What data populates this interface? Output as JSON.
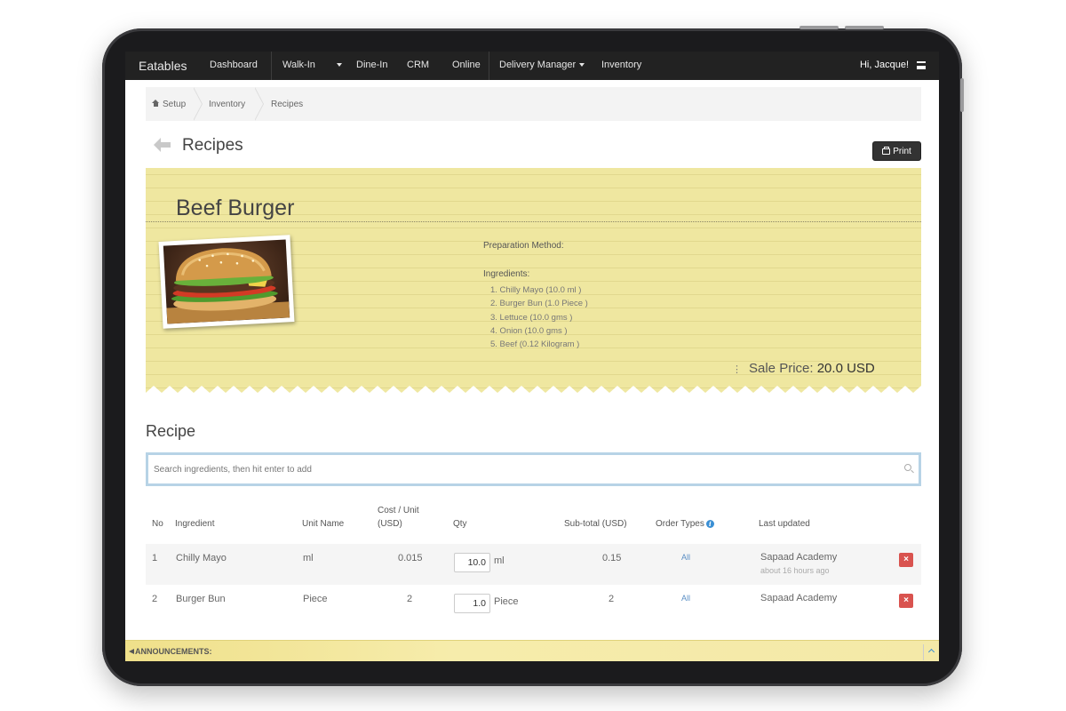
{
  "navbar": {
    "brand": "Eatables",
    "items": [
      "Dashboard",
      "Walk-In",
      "Dine-In",
      "CRM",
      "Online",
      "Delivery Manager",
      "Inventory"
    ],
    "user": "Hi, Jacque!"
  },
  "breadcrumb": [
    "Setup",
    "Inventory",
    "Recipes"
  ],
  "page": {
    "title": "Recipes",
    "print_label": "Print"
  },
  "card": {
    "title": "Beef Burger",
    "preparation_label": "Preparation Method:",
    "ingredients_label": "Ingredients:",
    "ingredients": [
      "1. Chilly Mayo (10.0 ml )",
      "2. Burger Bun (1.0 Piece )",
      "3. Lettuce (10.0 gms )",
      "4. Onion (10.0 gms )",
      "5. Beef (0.12 Kilogram )"
    ],
    "sale_label": "Sale Price:",
    "sale_value": "20.0 USD"
  },
  "recipe": {
    "title": "Recipe",
    "search_placeholder": "Search ingredients, then hit enter to add",
    "columns": {
      "no": "No",
      "ingredient": "Ingredient",
      "unit": "Unit Name",
      "cost_1": "Cost / Unit",
      "cost_2": "(USD)",
      "qty": "Qty",
      "subtotal": "Sub-total (USD)",
      "order_types": "Order Types",
      "updated": "Last updated"
    },
    "rows": [
      {
        "no": "1",
        "ingredient": "Chilly Mayo",
        "unit": "ml",
        "cost": "0.015",
        "qty": "10.0",
        "qty_unit": "ml",
        "subtotal": "0.15",
        "order_types": "All",
        "updated_by": "Sapaad Academy",
        "updated_at": "about 16 hours ago"
      },
      {
        "no": "2",
        "ingredient": "Burger Bun",
        "unit": "Piece",
        "cost": "2",
        "qty": "1.0",
        "qty_unit": "Piece",
        "subtotal": "2",
        "order_types": "All",
        "updated_by": "Sapaad Academy",
        "updated_at": ""
      }
    ]
  },
  "announcements": {
    "label": "ANNOUNCEMENTS:"
  },
  "colors": {
    "navbar": "#222222",
    "card": "#efe7a0",
    "delete": "#d9534f",
    "link": "#5a8ec4",
    "search_border": "#b7d3e6"
  }
}
